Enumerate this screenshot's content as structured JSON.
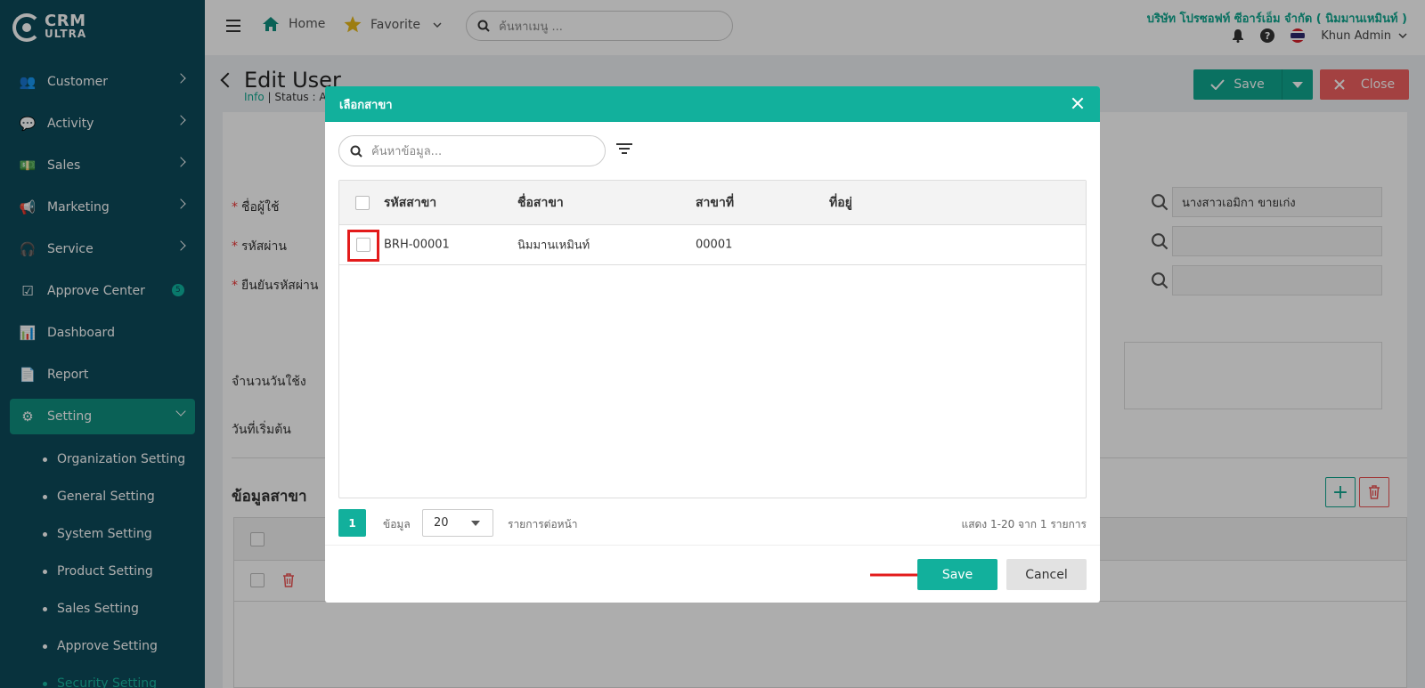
{
  "logo": {
    "line1": "CRM",
    "line2": "ULTRA"
  },
  "sidebar": {
    "items": [
      {
        "label": "Customer",
        "icon": "users-icon"
      },
      {
        "label": "Activity",
        "icon": "chat-icon"
      },
      {
        "label": "Sales",
        "icon": "money-icon"
      },
      {
        "label": "Marketing",
        "icon": "megaphone-icon"
      },
      {
        "label": "Service",
        "icon": "headset-icon"
      },
      {
        "label": "Approve Center",
        "icon": "clipboard-check-icon",
        "badge": "5"
      },
      {
        "label": "Dashboard",
        "icon": "bar-chart-icon"
      },
      {
        "label": "Report",
        "icon": "document-icon"
      },
      {
        "label": "Setting",
        "icon": "gear-icon"
      }
    ],
    "sub_items": [
      "Organization Setting",
      "General Setting",
      "System Setting",
      "Product Setting",
      "Sales Setting",
      "Approve Setting",
      "Security Setting"
    ]
  },
  "topbar": {
    "home": "Home",
    "favorite": "Favorite",
    "search_placeholder": "ค้นหาเมนู ...",
    "company": "บริษัท โปรซอฟท์ ซีอาร์เอ็ม จำกัด ( นิมมานเหมินท์ )",
    "user": "Khun Admin"
  },
  "page": {
    "title": "Edit User",
    "info": "Info",
    "status": "| Status : A",
    "save": "Save",
    "close": "Close",
    "fields": {
      "username": "ชื่อผู้ใช้",
      "password": "รหัสผ่าน",
      "confirm_password": "ยืนยันรหัสผ่าน",
      "days": "จำนวนวันใช้ง",
      "start_date": "วันที่เริ่มต้น",
      "full_name": "นางสาวเอมิกา ขายเก่ง"
    },
    "section_title": "ข้อมูลสาขา"
  },
  "modal": {
    "title": "เลือกสาขา",
    "search_placeholder": "ค้นหาข้อมูล...",
    "columns": [
      "รหัสสาขา",
      "ชื่อสาขา",
      "สาขาที่",
      "ที่อยู่"
    ],
    "rows": [
      [
        "BRH-00001",
        "นิมมานเหมินท์",
        "00001",
        ""
      ]
    ],
    "pager": {
      "page": "1",
      "label": "ข้อมูล",
      "per_page": "20",
      "suffix": "รายการต่อหน้า",
      "info": "แสดง 1-20 จาก 1 รายการ"
    },
    "save": "Save",
    "cancel": "Cancel"
  },
  "colors": {
    "sidebar": "#0d4a5a",
    "accent": "#12b09c",
    "danger": "#f06060",
    "highlight": "#e31b1b"
  }
}
